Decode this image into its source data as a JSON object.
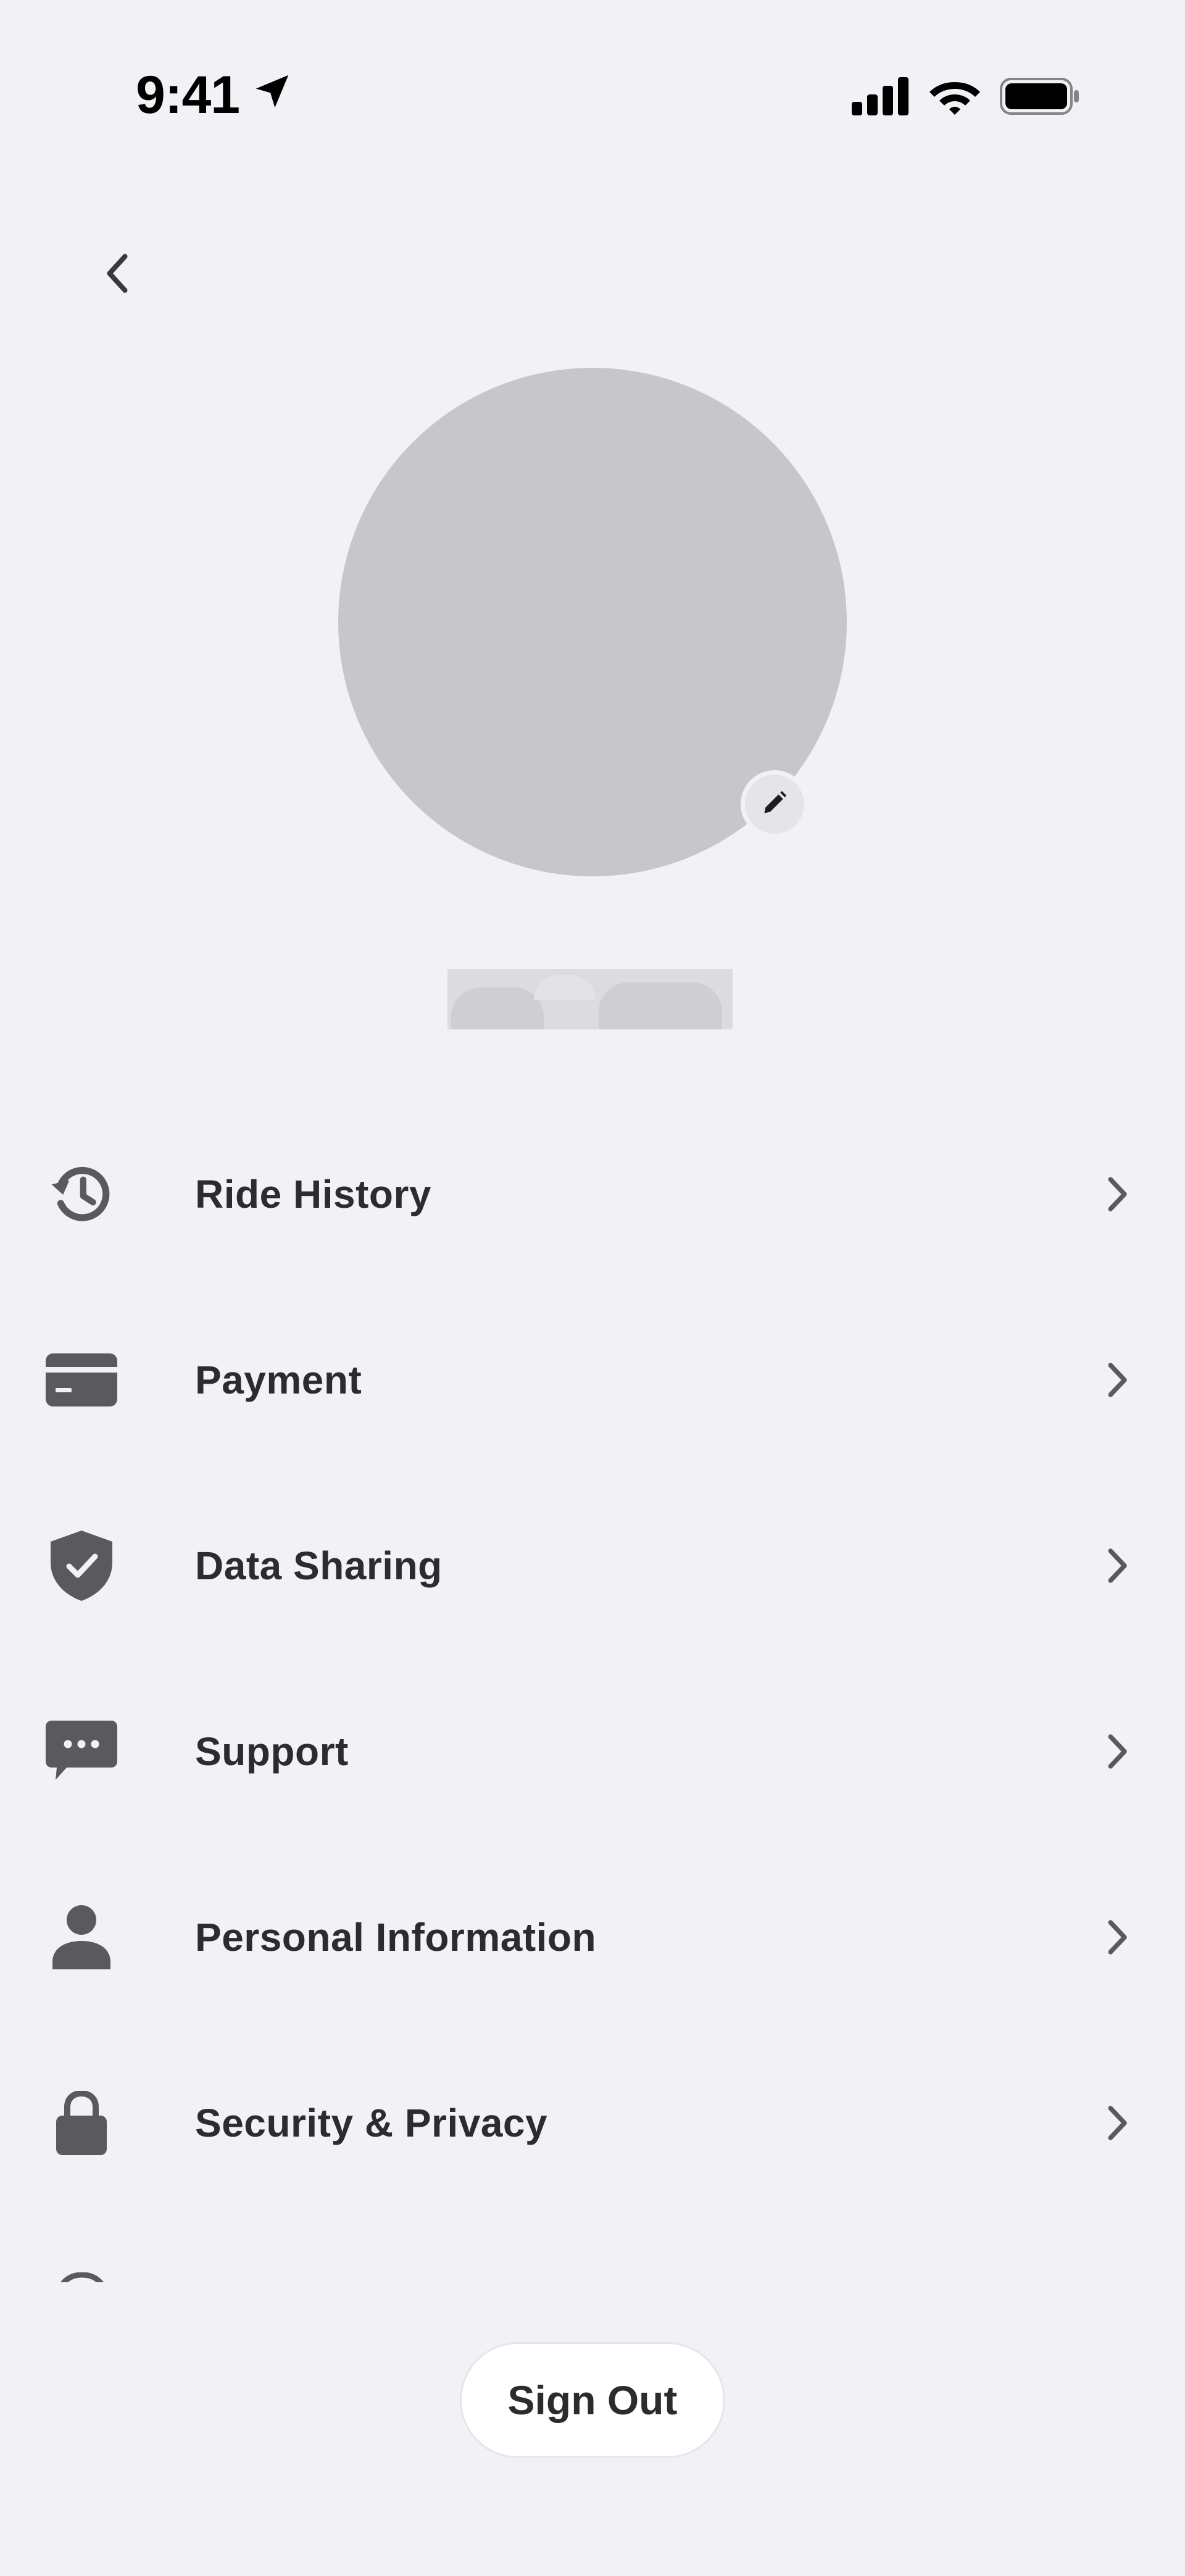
{
  "status_bar": {
    "time": "9:41"
  },
  "icons": {
    "back": "chevron-left-icon",
    "edit": "pencil-icon",
    "chevron": "chevron-right-icon"
  },
  "menu": {
    "items": [
      {
        "label": "Ride History",
        "icon": "history-icon"
      },
      {
        "label": "Payment",
        "icon": "credit-card-icon"
      },
      {
        "label": "Data Sharing",
        "icon": "shield-check-icon"
      },
      {
        "label": "Support",
        "icon": "chat-bubble-icon"
      },
      {
        "label": "Personal Information",
        "icon": "person-icon"
      },
      {
        "label": "Security & Privacy",
        "icon": "lock-icon"
      }
    ]
  },
  "sign_out": {
    "label": "Sign Out"
  },
  "colors": {
    "background": "#f2f1f5",
    "icon": "#5a595e",
    "avatar_placeholder": "#c7c6ca",
    "button_bg": "#ffffff"
  }
}
